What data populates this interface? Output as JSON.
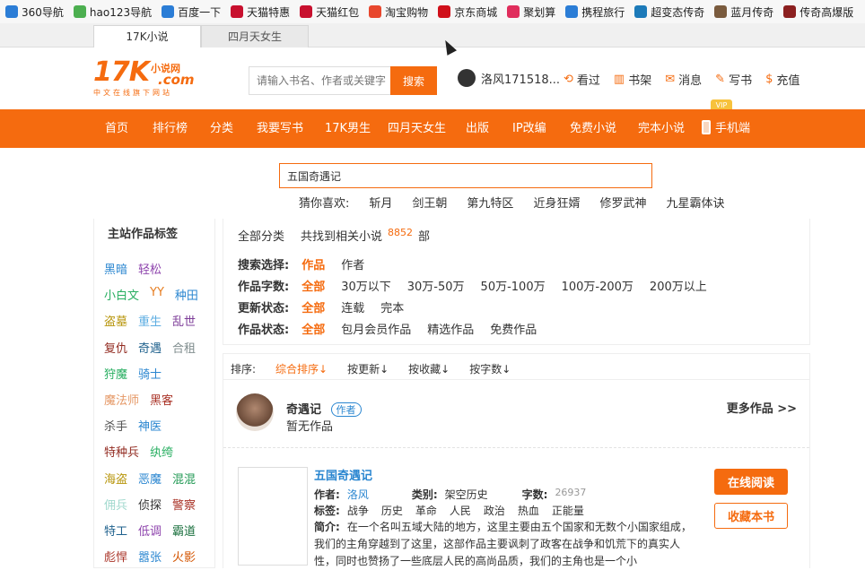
{
  "bookmarks": [
    {
      "label": "360导航",
      "color": "#2b7dd6",
      "icon": "360-icon"
    },
    {
      "label": "hao123导航",
      "color": "#4caf50",
      "icon": "hao123-icon"
    },
    {
      "label": "百度一下",
      "color": "#2b7dd6",
      "icon": "baidu-icon"
    },
    {
      "label": "天猫特惠",
      "color": "#c8102e",
      "icon": "tmall-icon"
    },
    {
      "label": "天猫红包",
      "color": "#c8102e",
      "icon": "tmall-icon"
    },
    {
      "label": "淘宝购物",
      "color": "#e8472d",
      "icon": "taobao-icon"
    },
    {
      "label": "京东商城",
      "color": "#d0101a",
      "icon": "jd-icon"
    },
    {
      "label": "聚划算",
      "color": "#e02d5c",
      "icon": "juhuasuan-icon"
    },
    {
      "label": "携程旅行",
      "color": "#2b7dd6",
      "icon": "ctrip-icon"
    },
    {
      "label": "超变态传奇",
      "color": "#1c7ab9",
      "icon": "game-icon"
    },
    {
      "label": "蓝月传奇",
      "color": "#7a5b3e",
      "icon": "game-icon"
    },
    {
      "label": "传奇高爆版",
      "color": "#8c2020",
      "icon": "game-icon"
    }
  ],
  "tabs": {
    "active": "17K小说",
    "inactive": "四月天女生"
  },
  "header": {
    "logo_main": "17K",
    "logo_small": "小说网",
    "logo_com": ".com",
    "logo_tag": "中文在线旗下网站",
    "search_placeholder": "请输入书名、作者或关键字",
    "search_button": "搜索",
    "username": "洛风171518...",
    "links": [
      {
        "label": "看过",
        "icon": "history-icon",
        "glyph": "⟲"
      },
      {
        "label": "书架",
        "icon": "bookshelf-icon",
        "glyph": "▥"
      },
      {
        "label": "消息",
        "icon": "message-icon",
        "glyph": "✉"
      },
      {
        "label": "写书",
        "icon": "write-icon",
        "glyph": "✎"
      },
      {
        "label": "充值",
        "icon": "recharge-icon",
        "glyph": "$"
      }
    ]
  },
  "nav": {
    "items": [
      "首页",
      "排行榜",
      "分类",
      "我要写书",
      "17K男生",
      "四月天女生",
      "出版",
      "IP改编",
      "免费小说",
      "完本小说",
      "手机端"
    ],
    "vip_badge": "VIP"
  },
  "result_search": {
    "value": "五国奇遇记",
    "guess_label": "猜你喜欢:",
    "guesses": [
      "斩月",
      "剑王朝",
      "第九特区",
      "近身狂婿",
      "修罗武神",
      "九星霸体诀"
    ]
  },
  "sidebar": {
    "title": "主站作品标签",
    "rows": [
      [
        {
          "t": "黑暗",
          "c": "#2a86d0"
        },
        {
          "t": "轻松",
          "c": "#8e44ad"
        }
      ],
      [
        {
          "t": "小白文",
          "c": "#27ae60"
        },
        {
          "t": "YY",
          "c": "#e67e22"
        },
        {
          "t": "种田",
          "c": "#2a86d0"
        }
      ],
      [
        {
          "t": "盗墓",
          "c": "#b7950b"
        },
        {
          "t": "重生",
          "c": "#5dade2"
        },
        {
          "t": "乱世",
          "c": "#7d3c98"
        }
      ],
      [
        {
          "t": "复仇",
          "c": "#922b21"
        },
        {
          "t": "奇遇",
          "c": "#1f618d"
        },
        {
          "t": "合租",
          "c": "#7f8c8d"
        }
      ],
      [
        {
          "t": "狩魔",
          "c": "#27ae60"
        },
        {
          "t": "骑士",
          "c": "#2a86d0"
        }
      ],
      [
        {
          "t": "魔法师",
          "c": "#e59866"
        },
        {
          "t": "黑客",
          "c": "#a93226"
        }
      ],
      [
        {
          "t": "杀手",
          "c": "#555555"
        },
        {
          "t": "神医",
          "c": "#2a86d0"
        }
      ],
      [
        {
          "t": "特种兵",
          "c": "#922b21"
        },
        {
          "t": "纨绔",
          "c": "#27ae60"
        }
      ],
      [
        {
          "t": "海盗",
          "c": "#b7950b"
        },
        {
          "t": "恶魔",
          "c": "#2a86d0"
        },
        {
          "t": "混混",
          "c": "#229954"
        }
      ],
      [
        {
          "t": "佣兵",
          "c": "#a2d9ce"
        },
        {
          "t": "侦探",
          "c": "#333333"
        },
        {
          "t": "警察",
          "c": "#a93226"
        }
      ],
      [
        {
          "t": "特工",
          "c": "#1f618d"
        },
        {
          "t": "低调",
          "c": "#8e44ad"
        },
        {
          "t": "霸道",
          "c": "#196f3d"
        }
      ],
      [
        {
          "t": "彪悍",
          "c": "#a93226"
        },
        {
          "t": "嚣张",
          "c": "#2a86d0"
        },
        {
          "t": "火影",
          "c": "#d35400"
        }
      ]
    ]
  },
  "filter": {
    "all_categories": "全部分类",
    "found_prefix": "共找到相关小说",
    "found_count": "8852",
    "found_suffix": "部",
    "rows": [
      {
        "label": "搜索选择:",
        "options": [
          "作品",
          "作者"
        ]
      },
      {
        "label": "作品字数:",
        "options": [
          "全部",
          "30万以下",
          "30万-50万",
          "50万-100万",
          "100万-200万",
          "200万以上"
        ]
      },
      {
        "label": "更新状态:",
        "options": [
          "全部",
          "连载",
          "完本"
        ]
      },
      {
        "label": "作品状态:",
        "options": [
          "全部",
          "包月会员作品",
          "精选作品",
          "免费作品"
        ]
      }
    ]
  },
  "sort": {
    "label": "排序:",
    "options": [
      "综合排序↓",
      "按更新↓",
      "按收藏↓",
      "按字数↓"
    ]
  },
  "author": {
    "name": "奇遇记",
    "badge": "作者",
    "works": "暂无作品",
    "more": "更多作品 >>"
  },
  "book": {
    "title": "五国奇遇记",
    "author_label": "作者:",
    "author": "洛风",
    "category_label": "类别:",
    "category": "架空历史",
    "words_label": "字数:",
    "words": "26937",
    "tags_label": "标签:",
    "tags": [
      "战争",
      "历史",
      "革命",
      "人民",
      "政治",
      "热血",
      "正能量"
    ],
    "desc_label": "简介:",
    "desc": "在一个名叫五域大陆的地方，这里主要由五个国家和无数个小国家组成，我们的主角穿越到了这里，这部作品主要讽刺了政客在战争和饥荒下的真实人性，同时也赞扬了一些底层人民的高尚品质，我们的主角也是一个小",
    "read_button": "在线阅读",
    "fav_button": "收藏本书"
  }
}
